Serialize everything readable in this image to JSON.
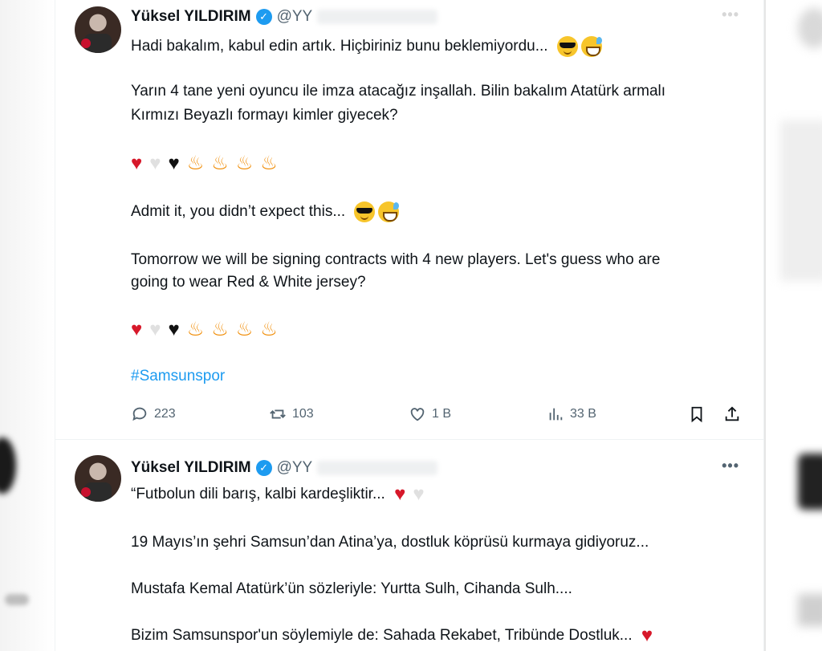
{
  "tweets": [
    {
      "author_name": "Yüksel YILDIRIM",
      "handle": "@YY",
      "lines": {
        "l1": "Hadi bakalım, kabul edin artık. Hiçbiriniz bunu beklemiyordu...",
        "l2": "Yarın 4 tane yeni oyuncu ile imza atacağız inşallah. Bilin bakalım Atatürk armalı",
        "l3": "Kırmızı Beyazlı formayı kimler  giyecek?",
        "l4": "Admit it, you didn’t expect this...",
        "l5": "Tomorrow we will be signing contracts with 4 new players. Let's guess who are",
        "l6": "going to wear Red & White jersey?",
        "hashtag": "#Samsunspor"
      },
      "stats": {
        "replies": "223",
        "reposts": "103",
        "likes": "1 B",
        "views": "33 B"
      }
    },
    {
      "author_name": "Yüksel YILDIRIM",
      "handle": "@YY",
      "more": "•••",
      "lines": {
        "l1": "“Futbolun dili barış, kalbi kardeşliktir...",
        "l2": "19 Mayıs’ın şehri Samsun’dan Atina’ya, dostluk köprüsü kurmaya gidiyoruz...",
        "l3": "Mustafa Kemal Atatürk’ün sözleriyle: Yurtta Sulh, Cihanda Sulh....",
        "l4": "Bizim Samsunspor'un söylemiyle de: Sahada Rekabet, Tribünde Dostluk..."
      }
    }
  ],
  "icons": {
    "verified": "verified-badge-icon",
    "reply": "reply-icon",
    "repost": "repost-icon",
    "like": "heart-icon",
    "views": "views-icon",
    "bookmark": "bookmark-icon",
    "share": "share-icon"
  },
  "colors": {
    "accent": "#1d9bf0",
    "text": "#0f1419",
    "muted": "#536471",
    "heart_red": "#d7182a"
  }
}
